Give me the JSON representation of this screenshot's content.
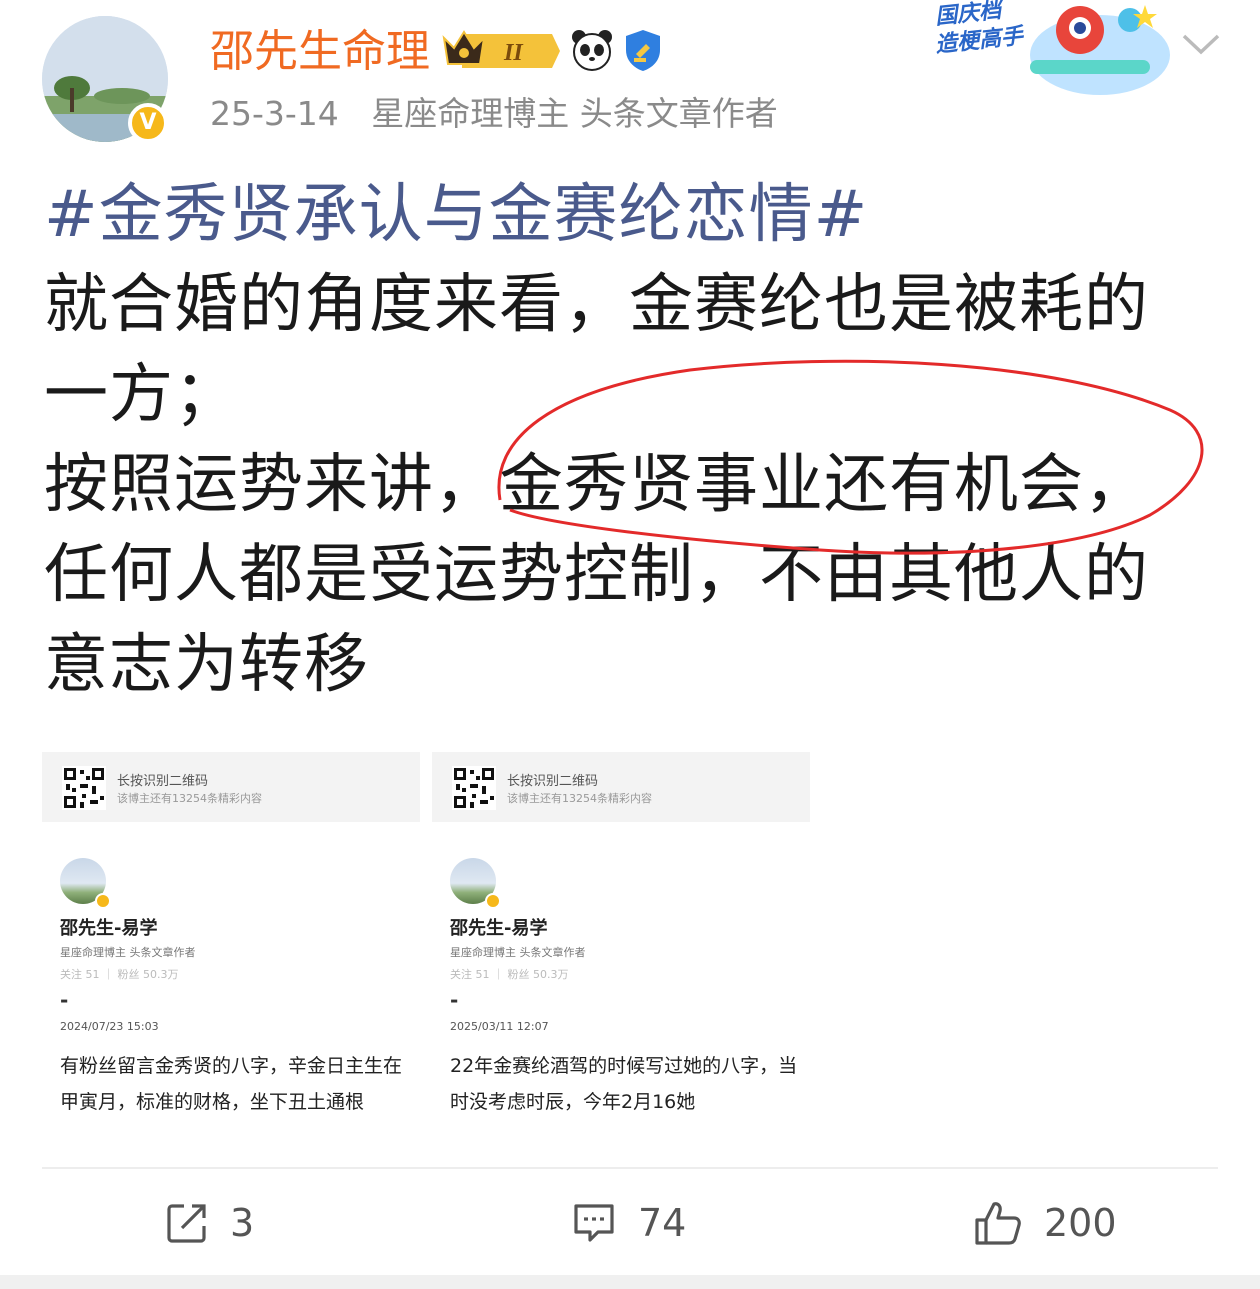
{
  "header": {
    "username": "邵先生命理",
    "date": "25-3-14",
    "tags": "星座命理博主 头条文章作者",
    "verified_badge": "V",
    "level_badge": "II",
    "promo": {
      "line1": "国庆档",
      "line2": "造梗高手"
    },
    "icons": [
      "crown-level-badge",
      "panda-icon",
      "shield-icon",
      "chevron-down-icon"
    ],
    "colors": {
      "username": "#f06a22",
      "meta": "#8a8a8a",
      "hashtag": "#4a5a8c"
    }
  },
  "post": {
    "hashtag": "#金秀贤承认与金赛纶恋情#",
    "lines": [
      "就合婚的角度来看，金赛纶也是被耗的",
      "一方；",
      "按照运势来讲，金秀贤事业还有机会，",
      "任何人都是受运势控制，不由其他人的",
      "意志为转移"
    ]
  },
  "cards": [
    {
      "qr_title": "长按识别二维码",
      "qr_sub": "该博主还有13254条精彩内容",
      "name": "邵先生-易学",
      "desc": "星座命理博主 头条文章作者",
      "stats": "关注 51 ｜ 粉丝 50.3万",
      "dash": "-",
      "date": "2024/07/23 15:03",
      "body": "有粉丝留言金秀贤的八字，辛金日主生在甲寅月，标准的财格，坐下丑土通根"
    },
    {
      "qr_title": "长按识别二维码",
      "qr_sub": "该博主还有13254条精彩内容",
      "name": "邵先生-易学",
      "desc": "星座命理博主 头条文章作者",
      "stats": "关注 51 ｜ 粉丝 50.3万",
      "dash": "-",
      "date": "2025/03/11 12:07",
      "body": "22年金赛纶酒驾的时候写过她的八字，当时没考虑时辰，今年2月16她"
    }
  ],
  "actions": {
    "share_count": "3",
    "comment_count": "74",
    "like_count": "200"
  }
}
